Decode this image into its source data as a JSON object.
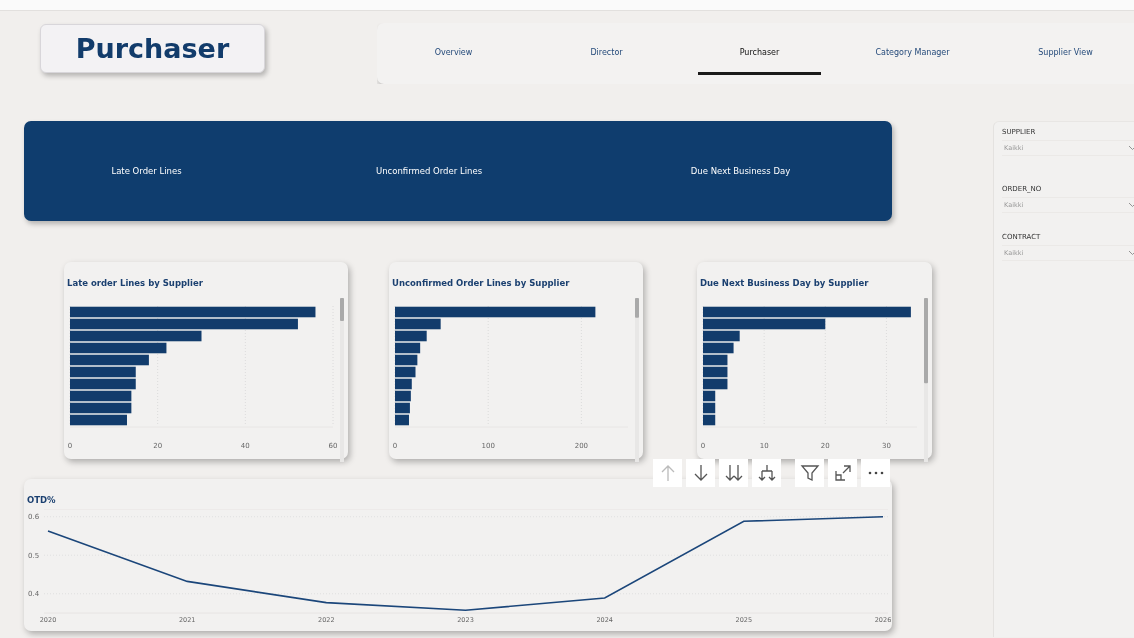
{
  "report_title": "Purchaser",
  "nav_tabs": [
    {
      "label": "Overview",
      "selected": false
    },
    {
      "label": "Director",
      "selected": false
    },
    {
      "label": "Purchaser",
      "selected": true
    },
    {
      "label": "Category Manager",
      "selected": false
    },
    {
      "label": "Supplier View",
      "selected": false
    }
  ],
  "kpi_banner": {
    "labels": [
      "Late Order Lines",
      "Unconfirmed Order Lines",
      "Due Next Business Day"
    ]
  },
  "bar_charts": [
    {
      "chart_data": {
        "type": "bar",
        "orientation": "horizontal",
        "title": "Late order Lines by Supplier",
        "values": [
          56,
          52,
          30,
          22,
          18,
          15,
          15,
          14,
          14,
          13
        ],
        "xlim": [
          0,
          60
        ],
        "xticks": [
          0,
          20,
          40,
          60
        ],
        "grid": true
      }
    },
    {
      "chart_data": {
        "type": "bar",
        "orientation": "horizontal",
        "title": "Unconfirmed Order Lines by Supplier",
        "values": [
          215,
          49,
          34,
          27,
          24,
          22,
          18,
          17,
          16,
          15
        ],
        "xlim": [
          0,
          250
        ],
        "xticks": [
          0,
          100,
          200
        ],
        "grid": true
      }
    },
    {
      "chart_data": {
        "type": "bar",
        "orientation": "horizontal",
        "title": "Due Next Business Day by Supplier",
        "values": [
          34,
          20,
          6,
          5,
          4,
          4,
          4,
          2,
          2,
          2
        ],
        "xlim": [
          0,
          35
        ],
        "xticks": [
          0,
          10,
          20,
          30
        ],
        "grid": true
      }
    }
  ],
  "line_chart": {
    "chart_data": {
      "type": "line",
      "title": "OTD%",
      "x": [
        "2020",
        "2021",
        "2022",
        "2023",
        "2024",
        "2025",
        "2026"
      ],
      "values": [
        0.563,
        0.432,
        0.377,
        0.357,
        0.389,
        0.588,
        0.6
      ],
      "ylim": [
        0.35,
        0.62
      ],
      "yticks": [
        0.4,
        0.5,
        0.6
      ],
      "grid": true
    }
  },
  "slicers": [
    {
      "label": "SUPPLIER",
      "value": "Kaikki"
    },
    {
      "label": "ORDER_NO",
      "value": "Kaikki"
    },
    {
      "label": "CONTRACT",
      "value": "Kaikki"
    }
  ]
}
